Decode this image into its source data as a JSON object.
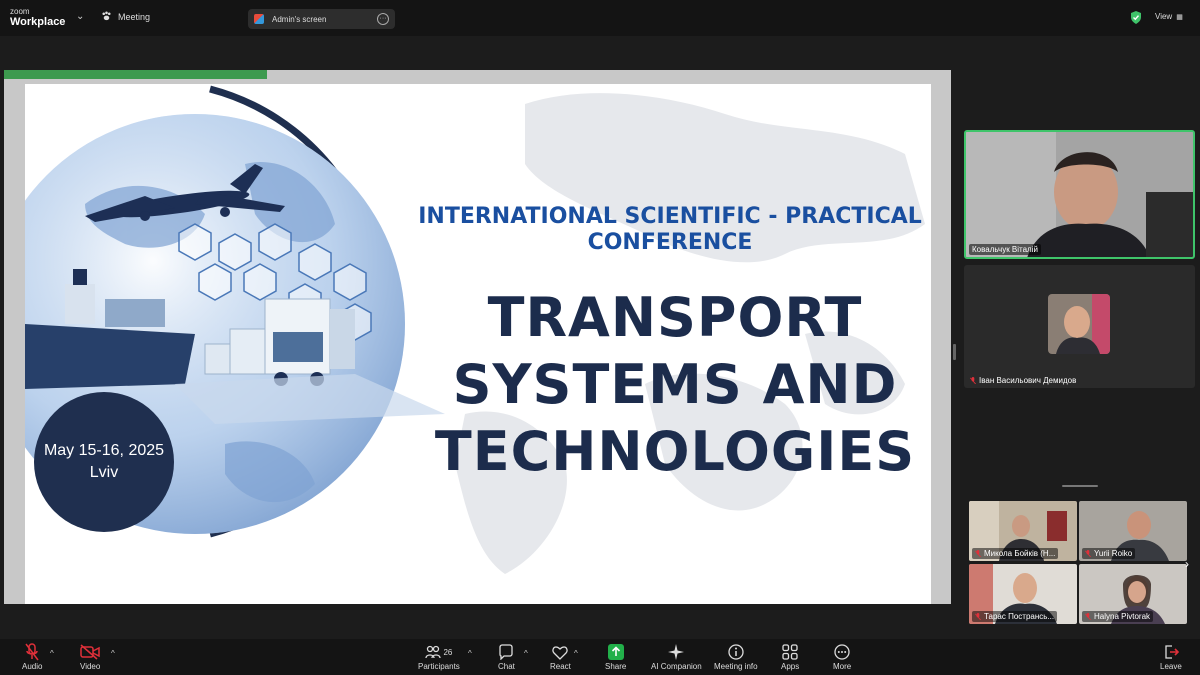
{
  "topbar": {
    "brand_small": "zoom",
    "brand_large": "Workplace",
    "meeting_label": "Meeting",
    "screen_label": "Admin's screen",
    "view_label": "View"
  },
  "slide": {
    "conference_line1": "INTERNATIONAL SCIENTIFIC - PRACTICAL",
    "conference_line2": "CONFERENCE",
    "title_line1": "TRANSPORT",
    "title_line2": "SYSTEMS AND",
    "title_line3": "TECHNOLOGIES",
    "date": "May 15-16, 2025",
    "city": "Lviv"
  },
  "participants": {
    "active_speaker": "Ковальчук Віталій",
    "second": "Іван Васильович Демидов",
    "grid": [
      "Микола Бойків (Н...",
      "Yurii Roiko",
      "Тарас Пострансь...",
      "Halyna Pivtorak"
    ]
  },
  "toolbar": {
    "audio": "Audio",
    "video": "Video",
    "participants": "Participants",
    "participants_count": "26",
    "chat": "Chat",
    "react": "React",
    "share": "Share",
    "ai_companion": "AI Companion",
    "meeting_info": "Meeting info",
    "apps": "Apps",
    "more": "More",
    "leave": "Leave"
  },
  "colors": {
    "active_speaker_border": "#3fc46a",
    "share_button": "#22b04a",
    "leave": "#e0303a",
    "slide_title": "#1c2c4c",
    "conference_blue": "#1a4fa0"
  }
}
